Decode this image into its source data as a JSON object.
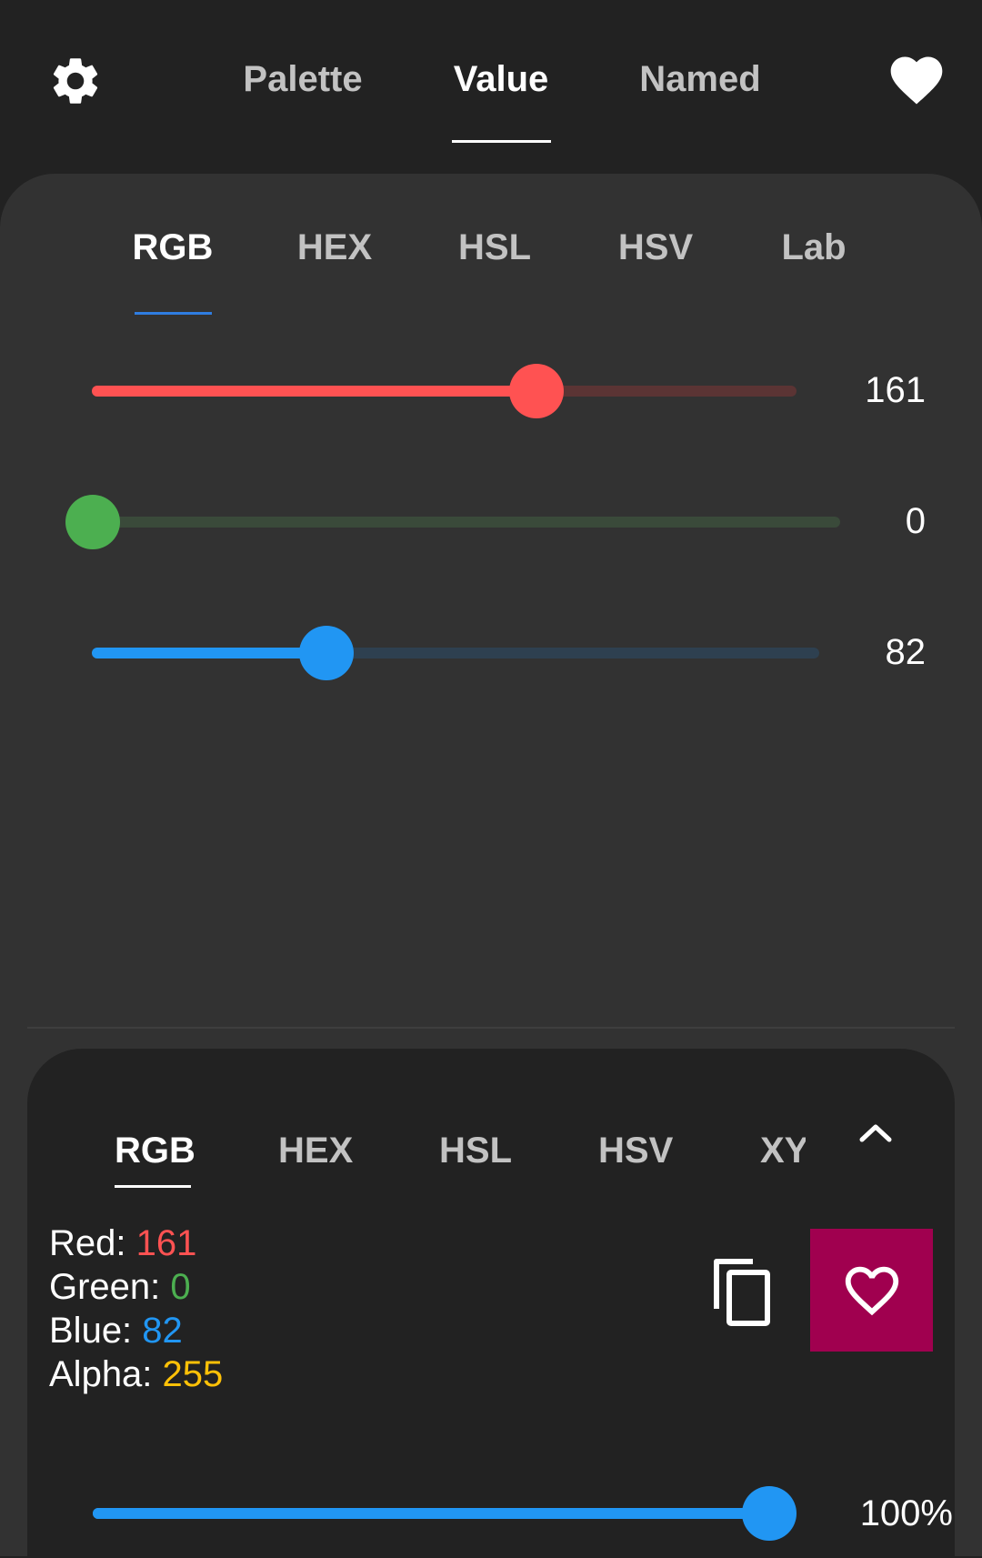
{
  "top_tabs": [
    {
      "label": "Palette",
      "active": false
    },
    {
      "label": "Value",
      "active": true
    },
    {
      "label": "Named",
      "active": false
    }
  ],
  "icons": {
    "settings": "gear-icon",
    "favorites": "heart-icon",
    "copy": "copy-icon",
    "add_favorite": "heart-outline-icon",
    "collapse": "chevron-up-icon"
  },
  "mode_tabs": [
    {
      "label": "RGB",
      "active": true
    },
    {
      "label": "HEX",
      "active": false
    },
    {
      "label": "HSL",
      "active": false
    },
    {
      "label": "HSV",
      "active": false
    },
    {
      "label": "Lab",
      "active": false
    }
  ],
  "sliders": {
    "red": {
      "value": "161",
      "fraction": 0.631,
      "color": "#ff5252",
      "track": "#5b3434"
    },
    "green": {
      "value": "0",
      "fraction": 0.0,
      "color": "#4caf50",
      "track": "#3a4a3a"
    },
    "blue": {
      "value": "82",
      "fraction": 0.322,
      "color": "#2196f3",
      "track": "#2e4050"
    }
  },
  "output_tabs": [
    {
      "label": "RGB",
      "active": true
    },
    {
      "label": "HEX",
      "active": false
    },
    {
      "label": "HSL",
      "active": false
    },
    {
      "label": "HSV",
      "active": false
    },
    {
      "label": "XY",
      "active": false
    }
  ],
  "readout": {
    "red": {
      "label": "Red: ",
      "value": "161",
      "color": "#ff5252"
    },
    "green": {
      "label": "Green: ",
      "value": "0",
      "color": "#4caf50"
    },
    "blue": {
      "label": "Blue: ",
      "value": "82",
      "color": "#2196f3"
    },
    "alpha": {
      "label": "Alpha: ",
      "value": "255",
      "color": "#ffc107"
    }
  },
  "alpha_slider": {
    "value": "100%",
    "fraction": 1.0,
    "color": "#2196f3"
  },
  "colors": {
    "accent_favorite": "#a0004f",
    "tab_underline": "#2f7de1"
  }
}
